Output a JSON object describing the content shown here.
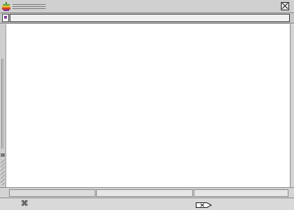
{
  "window": {
    "title_icon": "apple-rainbow-icon",
    "close_icon": "close-box-icon"
  },
  "toolbar": {
    "doc_icon": "document-icon"
  },
  "statusbar": {
    "command_glyph": "⌘",
    "tag_icon": "tag-arrow-icon"
  },
  "colors": {
    "chrome": "#d9d9d9",
    "content": "#ffffff",
    "border": "#8a8a8a"
  }
}
